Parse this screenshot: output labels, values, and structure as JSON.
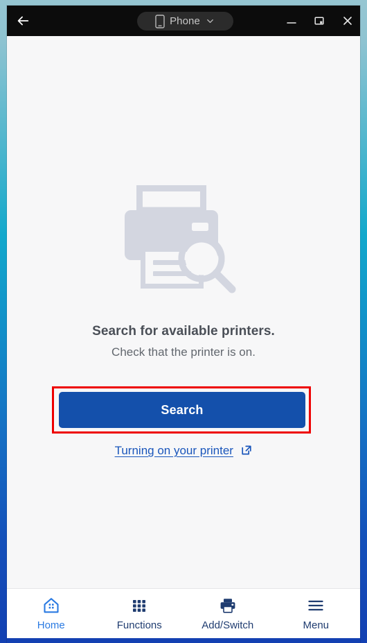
{
  "titlebar": {
    "back_icon": "back-arrow-icon",
    "device_chip": {
      "icon": "phone-icon",
      "label": "Phone",
      "chevron": "chevron-down-icon"
    },
    "minimize_label": "minimize-icon",
    "maximize_label": "restore-window-icon",
    "close_label": "close-icon"
  },
  "main": {
    "illustration": "printer-search-illustration",
    "headline": "Search for available printers.",
    "subheadline": "Check that the printer is on.",
    "search_button_label": "Search",
    "help_link_label": "Turning on your printer",
    "help_link_icon": "external-link-icon",
    "highlight_color": "#ee0000",
    "button_color": "#1450ab"
  },
  "bottom_nav": {
    "items": [
      {
        "label": "Home",
        "icon": "home-icon",
        "active": true
      },
      {
        "label": "Functions",
        "icon": "grid-apps-icon",
        "active": false
      },
      {
        "label": "Add/Switch",
        "icon": "printer-icon",
        "active": false
      },
      {
        "label": "Menu",
        "icon": "hamburger-menu-icon",
        "active": false
      }
    ],
    "active_color": "#2a7ae2",
    "inactive_color": "#1f3c70"
  }
}
